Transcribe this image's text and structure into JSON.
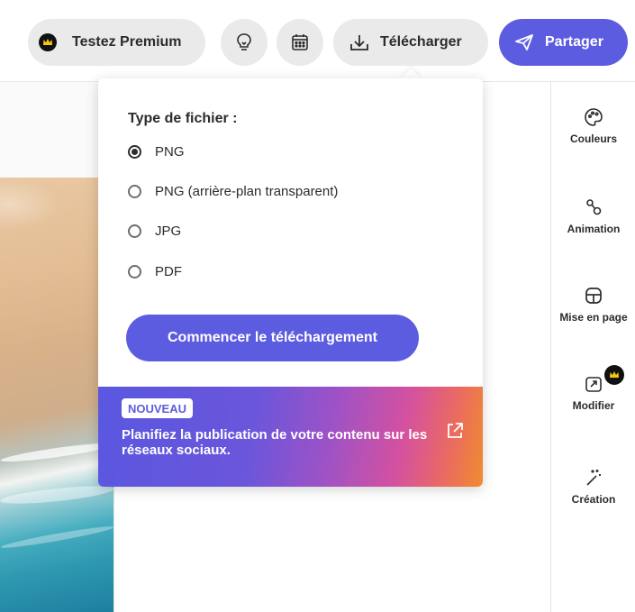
{
  "topbar": {
    "premium_label": "Testez Premium",
    "download_label": "Télécharger",
    "share_label": "Partager",
    "icons": [
      "crown-icon",
      "lightbulb-icon",
      "calendar-icon",
      "download-icon",
      "send-icon"
    ]
  },
  "popover": {
    "title": "Type de fichier :",
    "options": [
      {
        "label": "PNG",
        "checked": true
      },
      {
        "label": "PNG (arrière-plan transparent)",
        "checked": false
      },
      {
        "label": "JPG",
        "checked": false
      },
      {
        "label": "PDF",
        "checked": false
      }
    ],
    "start_button": "Commencer le téléchargement",
    "promo": {
      "badge": "NOUVEAU",
      "text": "Planifiez la publication de votre contenu sur les réseaux sociaux."
    }
  },
  "rail": {
    "items": [
      {
        "label": "Couleurs",
        "icon": "palette-icon"
      },
      {
        "label": "Animation",
        "icon": "animation-icon"
      },
      {
        "label": "Mise en page",
        "icon": "layout-icon"
      },
      {
        "label": "Modifier",
        "icon": "resize-icon",
        "premium": true
      },
      {
        "label": "Création",
        "icon": "magic-wand-icon"
      }
    ]
  },
  "colors": {
    "accent": "#5c5ce0",
    "pill_bg": "#eaeaea",
    "text": "#2c2c2c"
  }
}
